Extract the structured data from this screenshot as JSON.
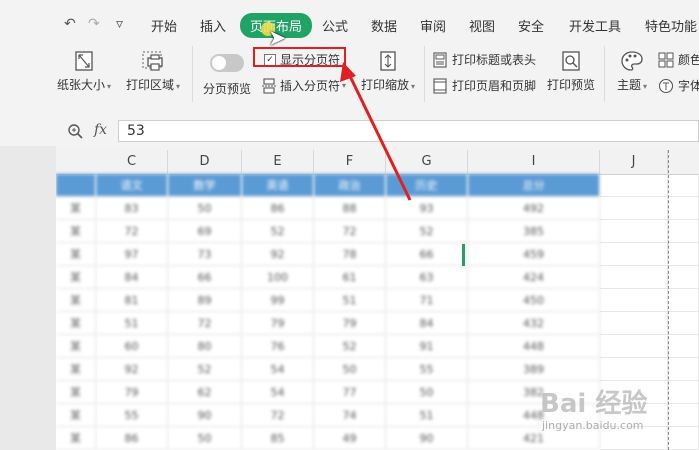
{
  "quick_access": {
    "undo": "↶",
    "redo": "↷",
    "more": "▿"
  },
  "tabs": [
    {
      "label": "开始"
    },
    {
      "label": "插入"
    },
    {
      "label": "页面布局"
    },
    {
      "label": "公式"
    },
    {
      "label": "数据"
    },
    {
      "label": "审阅"
    },
    {
      "label": "视图"
    },
    {
      "label": "安全"
    },
    {
      "label": "开发工具"
    },
    {
      "label": "特色功能"
    }
  ],
  "active_tab": "页面布局",
  "ribbon": {
    "paper_size": "纸张大小",
    "print_area": "打印区域",
    "page_break_preview": "分页预览",
    "show_page_breaks": "显示分页符",
    "show_page_breaks_checked": "✓",
    "insert_page_break": "插入分页符",
    "print_scale": "打印缩放",
    "print_titles": "打印标题或表头",
    "print_header_footer": "打印页眉和页脚",
    "print_preview": "打印预览",
    "theme": "主题",
    "color": "颜色",
    "font": "字体"
  },
  "formula_bar": {
    "fx": "fx",
    "value": "53"
  },
  "columns": [
    "C",
    "D",
    "E",
    "F",
    "G",
    "I",
    "J"
  ],
  "sheet": {
    "header_row": [
      "语文",
      "数学",
      "英语",
      "政治",
      "历史",
      "总分"
    ],
    "rows": [
      {
        "label": "某",
        "cells": [
          "83",
          "50",
          "86",
          "88",
          "93",
          "492"
        ]
      },
      {
        "label": "某",
        "cells": [
          "72",
          "69",
          "52",
          "72",
          "52",
          "385"
        ]
      },
      {
        "label": "某",
        "cells": [
          "97",
          "73",
          "92",
          "78",
          "66",
          "459"
        ]
      },
      {
        "label": "某",
        "cells": [
          "84",
          "66",
          "100",
          "61",
          "63",
          "424"
        ]
      },
      {
        "label": "某",
        "cells": [
          "81",
          "89",
          "99",
          "51",
          "71",
          "450"
        ]
      },
      {
        "label": "某",
        "cells": [
          "51",
          "72",
          "79",
          "79",
          "84",
          "432"
        ]
      },
      {
        "label": "某",
        "cells": [
          "60",
          "80",
          "76",
          "52",
          "91",
          "448"
        ]
      },
      {
        "label": "某",
        "cells": [
          "92",
          "52",
          "54",
          "50",
          "55",
          "389"
        ]
      },
      {
        "label": "某",
        "cells": [
          "79",
          "62",
          "54",
          "77",
          "50",
          "382"
        ]
      },
      {
        "label": "某",
        "cells": [
          "55",
          "90",
          "72",
          "74",
          "51",
          "448"
        ]
      },
      {
        "label": "某",
        "cells": [
          "86",
          "50",
          "85",
          "49",
          "90",
          "421"
        ]
      }
    ]
  },
  "watermark": {
    "brand": "Bai 经验",
    "url": "jingyan.baidu.com"
  },
  "colors": {
    "accent": "#21a366",
    "highlight": "#e02020",
    "table_header": "#5b9bd5"
  }
}
